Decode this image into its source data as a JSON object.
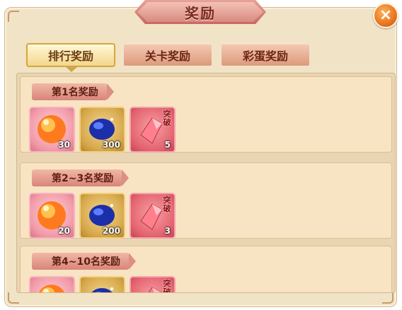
{
  "window": {
    "title": "奖励",
    "close_label": "×"
  },
  "tabs": [
    {
      "label": "排行奖励",
      "active": true
    },
    {
      "label": "关卡奖励",
      "active": false
    },
    {
      "label": "彩蛋奖励",
      "active": false
    }
  ],
  "sections": [
    {
      "title": "第1名奖励",
      "items": [
        {
          "icon": "fire-orb-icon",
          "quantity": "30"
        },
        {
          "icon": "blue-gem-icon",
          "quantity": "300"
        },
        {
          "icon": "breakthrough-crystal-icon",
          "quantity": "5",
          "tag": "突破"
        }
      ]
    },
    {
      "title": "第2~3名奖励",
      "items": [
        {
          "icon": "fire-orb-icon",
          "quantity": "20"
        },
        {
          "icon": "blue-gem-icon",
          "quantity": "200"
        },
        {
          "icon": "breakthrough-crystal-icon",
          "quantity": "3",
          "tag": "突破"
        }
      ]
    },
    {
      "title": "第4~10名奖励",
      "items": [
        {
          "icon": "fire-orb-icon",
          "quantity": ""
        },
        {
          "icon": "blue-gem-icon",
          "quantity": ""
        },
        {
          "icon": "breakthrough-crystal-icon",
          "quantity": "",
          "tag": "突破"
        }
      ]
    }
  ],
  "colors": {
    "accent_orange": "#e46a17",
    "title_red": "#7a2a1e",
    "panel_bg": "#f1e3c6"
  }
}
